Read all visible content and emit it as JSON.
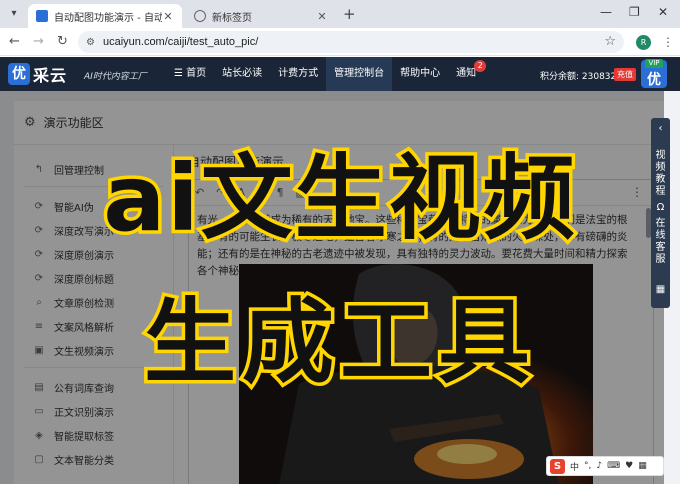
{
  "browser": {
    "active_tab_title": "自动配图功能演示 - 自动文章采",
    "inactive_tab_title": "新标签页",
    "url": "ucaiyun.com/caiji/test_auto_pic/",
    "profile_initial": "R"
  },
  "site": {
    "logo_mark": "优",
    "logo_text": "采云",
    "slogan": "AI时代内容工厂",
    "nav": [
      {
        "label": "首页",
        "icon": "menu-icon"
      },
      {
        "label": "站长必读"
      },
      {
        "label": "计费方式"
      },
      {
        "label": "管理控制台",
        "active": true
      },
      {
        "label": "帮助中心"
      },
      {
        "label": "通知",
        "badge": "2"
      }
    ],
    "points": "积分余额: 2308329",
    "charge_label": "充值",
    "vip_tag": "VIP",
    "vip_mark": "优"
  },
  "panel": {
    "title": "演示功能区",
    "back_item": "回管理控制",
    "menu": [
      {
        "label": "智能AI伪",
        "icon": "refresh-icon"
      },
      {
        "label": "深度改写演示",
        "icon": "refresh-icon"
      },
      {
        "label": "深度原创演示",
        "icon": "refresh-icon"
      },
      {
        "label": "深度原创标题",
        "icon": "refresh-icon"
      },
      {
        "label": "文章原创检测",
        "icon": "search-icon"
      },
      {
        "label": "文案风格解析",
        "icon": "list-icon"
      },
      {
        "label": "文生视频演示",
        "icon": "video-icon"
      },
      {
        "label": "公有词库查询",
        "icon": "book-icon"
      },
      {
        "label": "正文识别演示",
        "icon": "monitor-icon"
      },
      {
        "label": "智能提取标签",
        "icon": "tag-icon"
      },
      {
        "label": "文本智能分类",
        "icon": "chat-icon"
      }
    ],
    "editor_label": "自动配图功能演示",
    "editor_text": "有光，要寻觅就成为稀有的天材地宝。这些稀有宝藏具备特殊的属性和力量，它们是法宝的根基。有的可能生长于极寒之地，蕴含着冰寒之力；有的则来自炽热的火山深处，带有磅礴的炎能；还有的是在神秘的古老遗迹中被发现，具有独特的灵力波动。要花费大量时间和精力探索各个神秘之地，才能获得它们。"
  },
  "float_help": {
    "video_tutorial": "视频教程",
    "online_service": "在线客服"
  },
  "headline": {
    "line1": "ai文生视频",
    "line2": "生成工具"
  },
  "ime": {
    "logo": "S",
    "mode": "中"
  },
  "colors": {
    "header_bg": "#1a2637",
    "highlight_yellow": "#ffd600",
    "badge_red": "#e23b3b",
    "brand_blue": "#2b6fd6"
  }
}
